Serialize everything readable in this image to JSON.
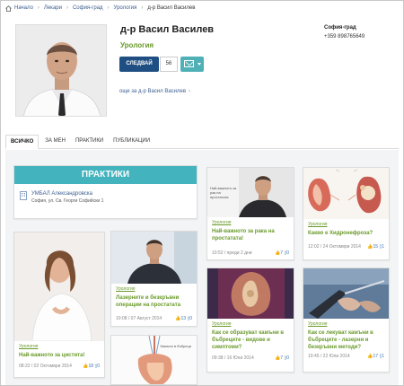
{
  "breadcrumb": [
    "Начало",
    "Лекари",
    "София-град",
    "Урология",
    "д-р Васил Василев"
  ],
  "profile": {
    "name": "д-р Васил Василев",
    "specialty": "Урология",
    "follow_label": "СЛЕДВАЙ",
    "follow_count": "56",
    "more_link": "още за д-р Васил Василев",
    "city": "София-град",
    "phone": "+359 898765649"
  },
  "tabs": [
    "ВСИЧКО",
    "ЗА МЕН",
    "ПРАКТИКИ",
    "ПУБЛИКАЦИИ"
  ],
  "practices": {
    "header": "ПРАКТИКИ",
    "name": "УМБАЛ Александровска",
    "address": "София, ул. Св. Георги Софийски 1"
  },
  "cards": [
    {
      "category": "Урология",
      "title": "Най-важното за рака на простатата!",
      "meta": "10:52 / преди 2 дни",
      "likes": "7",
      "comments": "0"
    },
    {
      "category": "Урология",
      "title": "Какво е Хидронефроза?",
      "meta": "12:02 / 24 Октомври 2014",
      "likes": "15",
      "comments": "1"
    },
    {
      "category": "Урология",
      "title": "Лазерните и безкръвни операции на простатата",
      "meta": "10:08 / 07 Август 2014",
      "likes": "13",
      "comments": "0"
    },
    {
      "category": "Урология",
      "title": "Най-важното за цистита!",
      "meta": "08:22 / 02 Октомври 2014",
      "likes": "18",
      "comments": "0"
    },
    {
      "category": "Урология",
      "title": "Как се образуват камъни в бъбреците - видове и симптоми?",
      "meta": "09:38 / 16 Юни 2014",
      "likes": "7",
      "comments": "0"
    },
    {
      "category": "Урология",
      "title": "Как се лекуват камъни в бъбреците - лазерни и безкръвни методи?",
      "meta": "10:45 / 22 Юли 2014",
      "likes": "17",
      "comments": "1"
    }
  ],
  "image_captions": {
    "video_thumb": "Най-важното за рак на простатата",
    "kidney_thumb": "Камъни в бъбреци"
  },
  "colors": {
    "accent_green": "#6a9a2a",
    "follow_blue": "#1f4f82",
    "teal": "#43b3be"
  }
}
